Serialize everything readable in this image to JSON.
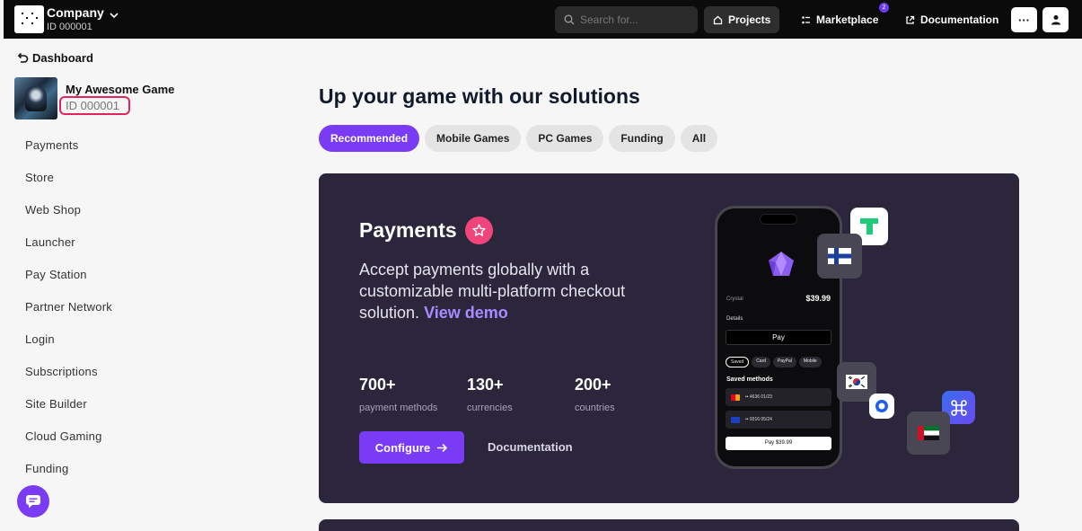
{
  "topbar": {
    "company_name": "Company",
    "company_id": "ID 000001",
    "search_placeholder": "Search for...",
    "projects_label": "Projects",
    "marketplace_label": "Marketplace",
    "marketplace_badge": "2",
    "documentation_label": "Documentation",
    "more_label": "···"
  },
  "sidebar": {
    "back_label": "Dashboard",
    "game_title": "My Awesome Game",
    "game_id": "ID 000001",
    "items": [
      "Payments",
      "Store",
      "Web Shop",
      "Launcher",
      "Pay Station",
      "Partner Network",
      "Login",
      "Subscriptions",
      "Site Builder",
      "Cloud Gaming",
      "Funding"
    ]
  },
  "main": {
    "title": "Up your game with our solutions",
    "tabs": [
      "Recommended",
      "Mobile Games",
      "PC Games",
      "Funding",
      "All"
    ],
    "active_tab": "Recommended"
  },
  "hero": {
    "title": "Payments",
    "desc": "Accept payments globally with a customizable multi-platform checkout solution.",
    "demo_link": "View demo",
    "stats": [
      {
        "num": "700+",
        "label": "payment methods"
      },
      {
        "num": "130+",
        "label": "currencies"
      },
      {
        "num": "200+",
        "label": "countries"
      }
    ],
    "configure_label": "Configure",
    "docs_label": "Documentation",
    "accent": "#7a3bf5"
  },
  "phone": {
    "item": "Crystal",
    "price": "$39.99",
    "details": "Details",
    "apple_pay": " Pay",
    "chips": [
      "Saved",
      "Card",
      "PayPal",
      "Mobile"
    ],
    "saved_methods": "Saved methods",
    "card1": "•• 4636  01/23",
    "card2": "•• 9316  05/24",
    "pay_label": "Pay $39.99"
  }
}
